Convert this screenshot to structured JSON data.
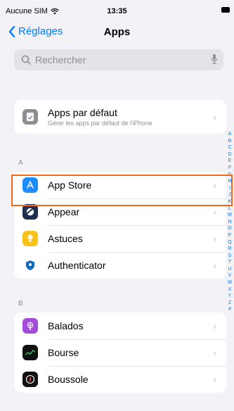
{
  "status_bar": {
    "carrier": "Aucune SIM",
    "time": "13:35"
  },
  "nav": {
    "back_label": "Réglages",
    "title": "Apps"
  },
  "search": {
    "placeholder": "Rechercher"
  },
  "defaults_card": {
    "title": "Apps par défaut",
    "subtitle": "Gérer les apps par défaut de l'iPhone"
  },
  "sections": [
    {
      "letter": "A",
      "items": [
        {
          "label": "App Store",
          "icon": "app-store-icon",
          "color": "#1e8bff"
        },
        {
          "label": "Appear",
          "icon": "appear-icon",
          "color": "#1f2f50"
        },
        {
          "label": "Astuces",
          "icon": "tips-icon",
          "color": "#f7c21a"
        },
        {
          "label": "Authenticator",
          "icon": "authenticator-icon",
          "color": "#ffffff"
        }
      ]
    },
    {
      "letter": "B",
      "items": [
        {
          "label": "Balados",
          "icon": "podcasts-icon",
          "color": "#a44bd9"
        },
        {
          "label": "Bourse",
          "icon": "stocks-icon",
          "color": "#111111"
        },
        {
          "label": "Boussole",
          "icon": "compass-icon",
          "color": "#111111"
        }
      ]
    }
  ],
  "index_letters": [
    "A",
    "B",
    "C",
    "D",
    "E",
    "F",
    "G",
    "H",
    "I",
    "J",
    "K",
    "L",
    "M",
    "N",
    "O",
    "P",
    "Q",
    "R",
    "S",
    "T",
    "U",
    "V",
    "W",
    "X",
    "Y",
    "Z",
    "#"
  ],
  "colors": {
    "accent": "#007aff",
    "highlight": "#f26a1b",
    "background": "#f2f2f7"
  }
}
